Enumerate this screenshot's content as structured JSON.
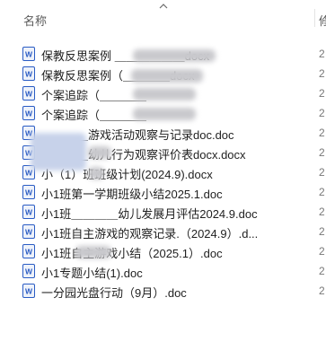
{
  "header": {
    "name_column": "名称",
    "next_column_letter": "修"
  },
  "files": [
    {
      "name": "保教反思案例 ＿＿＿＿＿＿docx",
      "date_stub": "2"
    },
    {
      "name": "保教反思案例（＿＿＿＿docx",
      "date_stub": "2"
    },
    {
      "name": "个案追踪（＿＿＿＿",
      "date_stub": "2"
    },
    {
      "name": "个案追踪（＿＿＿＿",
      "date_stub": "2"
    },
    {
      "name": "＿＿＿＿游戏活动观察与记录doc.doc",
      "date_stub": "2"
    },
    {
      "name": "＿＿＿＿幼儿行为观察评价表docx.docx",
      "date_stub": "2"
    },
    {
      "name": "小（1）班班级计划(2024.9).docx",
      "date_stub": "2"
    },
    {
      "name": "小1班第一学期班级小结2025.1.doc",
      "date_stub": "2"
    },
    {
      "name": "小1班＿＿＿＿幼儿发展月评估2024.9.doc",
      "date_stub": "2"
    },
    {
      "name": "小1班自主游戏的观察记录.（2024.9）.d...",
      "date_stub": "2"
    },
    {
      "name": "小1班自主游戏小结（2025.1）.doc",
      "date_stub": "2"
    },
    {
      "name": "小1专题小结(1).doc",
      "date_stub": "2"
    },
    {
      "name": "一分园光盘行动（9月）.doc",
      "date_stub": "2"
    }
  ],
  "colors": {
    "word_blue": "#2b5cc4",
    "text": "#1f1f1f",
    "header_text": "#5a5a5a"
  },
  "icons": {
    "file": "word-document-icon",
    "sort": "sort-ascending-icon"
  }
}
